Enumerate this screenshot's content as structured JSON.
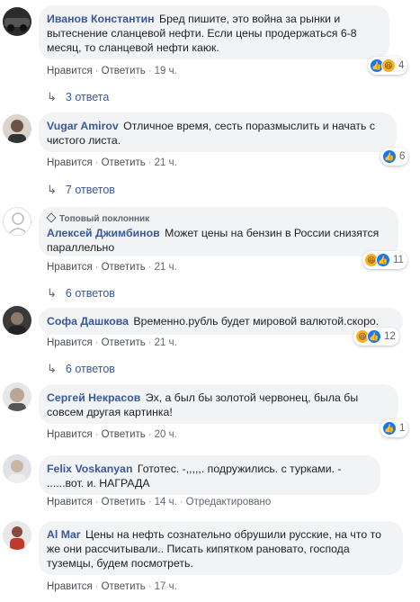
{
  "comments": [
    {
      "author": "Иванов Константин",
      "text": "Бред пишите, это война за рынки и вытеснение сланцевой нефти. Если цены продержаться 6-8 месяц, то сланцевой нефти каюк.",
      "like_label": "Нравится",
      "reply_label": "Ответить",
      "time": "19 ч.",
      "reactions": [
        "like",
        "haha"
      ],
      "reaction_count": "4",
      "replies": "3 ответа"
    },
    {
      "author": "Vugar Amirov",
      "text": "Отличное время, сесть поразмыслить и начать с чистого листа.",
      "like_label": "Нравится",
      "reply_label": "Ответить",
      "time": "21 ч.",
      "reactions": [
        "like"
      ],
      "reaction_count": "6",
      "replies": "7 ответов"
    },
    {
      "badge": "Топовый поклонник",
      "author": "Алексей Джимбинов",
      "text": "Может цены на бензин в России снизятся параллельно",
      "like_label": "Нравится",
      "reply_label": "Ответить",
      "time": "21 ч.",
      "reactions": [
        "haha",
        "like"
      ],
      "reaction_count": "11",
      "replies": "6 ответов"
    },
    {
      "author": "Софа Дашкова",
      "text": "Временно.рубль будет мировой валютой.скоро.",
      "like_label": "Нравится",
      "reply_label": "Ответить",
      "time": "21 ч.",
      "reactions": [
        "haha",
        "like"
      ],
      "reaction_count": "12",
      "replies": "6 ответов"
    },
    {
      "author": "Сергей Некрасов",
      "text": "Эх, а был бы золотой червонец, была бы совсем другая картинка!",
      "like_label": "Нравится",
      "reply_label": "Ответить",
      "time": "20 ч.",
      "reactions": [
        "like"
      ],
      "reaction_count": "1"
    },
    {
      "author": "Felix Voskanyan",
      "text": "Гототес. -,,,,,. подружились. с турками. - ......вот. и. НАГРАДА",
      "like_label": "Нравится",
      "reply_label": "Ответить",
      "time": "14 ч.",
      "edited": "Отредактировано"
    },
    {
      "author": "Al Mar",
      "text": "Цены на нефть сознательно обрушили русские, на что то же они рассчитывали.. Писать кипятком рановато, господа туземцы, будем посмотреть.",
      "like_label": "Нравится",
      "reply_label": "Ответить",
      "time": "17 ч."
    }
  ],
  "colors": {
    "author": "#385898",
    "bubble": "#f2f3f5",
    "like": "#1877f2",
    "haha": "#f7b125"
  }
}
